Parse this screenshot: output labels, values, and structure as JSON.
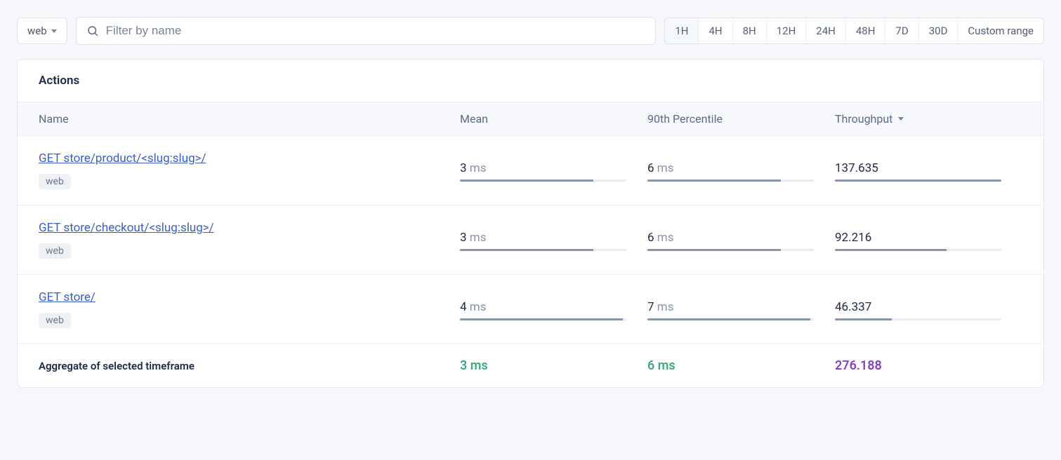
{
  "filter": {
    "scope": "web",
    "search_placeholder": "Filter by name"
  },
  "ranges": [
    "1H",
    "4H",
    "8H",
    "12H",
    "24H",
    "48H",
    "7D",
    "30D",
    "Custom range"
  ],
  "panel": {
    "title": "Actions",
    "columns": {
      "name": "Name",
      "mean": "Mean",
      "p90": "90th Percentile",
      "throughput": "Throughput"
    }
  },
  "rows": [
    {
      "name": "GET store/product/<slug:slug>/",
      "tag": "web",
      "mean": {
        "value": "3",
        "unit": "ms",
        "fill": 80
      },
      "p90": {
        "value": "6",
        "unit": "ms",
        "fill": 80
      },
      "throughput": {
        "value": "137.635",
        "fill": 100
      }
    },
    {
      "name": "GET store/checkout/<slug:slug>/",
      "tag": "web",
      "mean": {
        "value": "3",
        "unit": "ms",
        "fill": 80
      },
      "p90": {
        "value": "6",
        "unit": "ms",
        "fill": 80
      },
      "throughput": {
        "value": "92.216",
        "fill": 67
      }
    },
    {
      "name": "GET store/",
      "tag": "web",
      "mean": {
        "value": "4",
        "unit": "ms",
        "fill": 98
      },
      "p90": {
        "value": "7",
        "unit": "ms",
        "fill": 98
      },
      "throughput": {
        "value": "46.337",
        "fill": 34
      }
    }
  ],
  "aggregate": {
    "label": "Aggregate of selected timeframe",
    "mean": {
      "value": "3",
      "unit": "ms"
    },
    "p90": {
      "value": "6",
      "unit": "ms"
    },
    "throughput": "276.188"
  }
}
